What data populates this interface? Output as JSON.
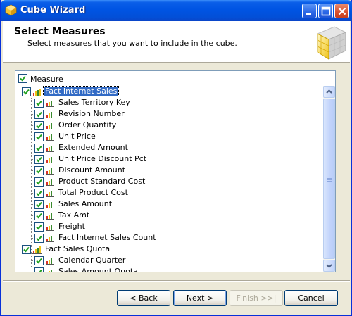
{
  "window": {
    "title": "Cube Wizard",
    "title_icon": "cube-wizard-icon"
  },
  "header": {
    "title": "Select Measures",
    "subtitle": "Select measures that you want to include in the cube."
  },
  "tree": {
    "header_label": "Measure",
    "header_checked": true,
    "groups": [
      {
        "label": "Fact Internet Sales",
        "checked": true,
        "selected": true,
        "items": [
          {
            "label": "Sales Territory Key",
            "checked": true
          },
          {
            "label": "Revision Number",
            "checked": true
          },
          {
            "label": "Order Quantity",
            "checked": true
          },
          {
            "label": "Unit Price",
            "checked": true
          },
          {
            "label": "Extended Amount",
            "checked": true
          },
          {
            "label": "Unit Price Discount Pct",
            "checked": true
          },
          {
            "label": "Discount Amount",
            "checked": true
          },
          {
            "label": "Product Standard Cost",
            "checked": true
          },
          {
            "label": "Total Product Cost",
            "checked": true
          },
          {
            "label": "Sales Amount",
            "checked": true
          },
          {
            "label": "Tax Amt",
            "checked": true
          },
          {
            "label": "Freight",
            "checked": true
          },
          {
            "label": "Fact Internet Sales Count",
            "checked": true
          }
        ]
      },
      {
        "label": "Fact Sales Quota",
        "checked": true,
        "selected": false,
        "items": [
          {
            "label": "Calendar Quarter",
            "checked": true
          },
          {
            "label": "Sales Amount Quota",
            "checked": true
          }
        ]
      }
    ]
  },
  "buttons": {
    "back": "< Back",
    "next": "Next >",
    "finish": "Finish >>|",
    "cancel": "Cancel"
  },
  "colors": {
    "titlebar": "#0054e3",
    "selection": "#316ac5",
    "check": "#21a121"
  }
}
